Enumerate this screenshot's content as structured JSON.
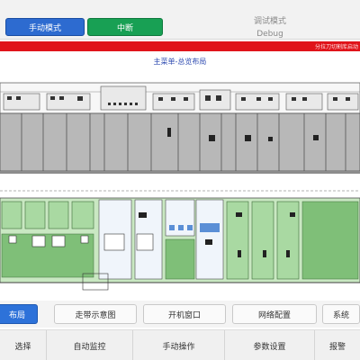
{
  "top": {
    "manual_mode_label": "手动模式",
    "pause_label": "中断",
    "debug_title": "调试模式",
    "debug_subtitle": "Debug"
  },
  "alarm": {
    "text": "分拉刀切割库启动"
  },
  "main_title": "主菜单-总览布局",
  "nav": {
    "row1": [
      {
        "label": "布局",
        "active": true
      },
      {
        "label": "走带示意图",
        "active": false
      },
      {
        "label": "开机窗口",
        "active": false
      },
      {
        "label": "网络配置",
        "active": false
      },
      {
        "label": "系统",
        "active": false
      }
    ],
    "row2": [
      {
        "label": "选择"
      },
      {
        "label": "自动监控"
      },
      {
        "label": "手动操作"
      },
      {
        "label": "参数设置"
      },
      {
        "label": "报警"
      }
    ]
  },
  "colors": {
    "manual_blue": "#2d6bd0",
    "pause_green": "#18a054",
    "alarm_red": "#e0141a",
    "active_nav": "#2d72d9",
    "cabinet_gray": "#b8b8b8",
    "cabinet_green": "#a9d9a2"
  }
}
